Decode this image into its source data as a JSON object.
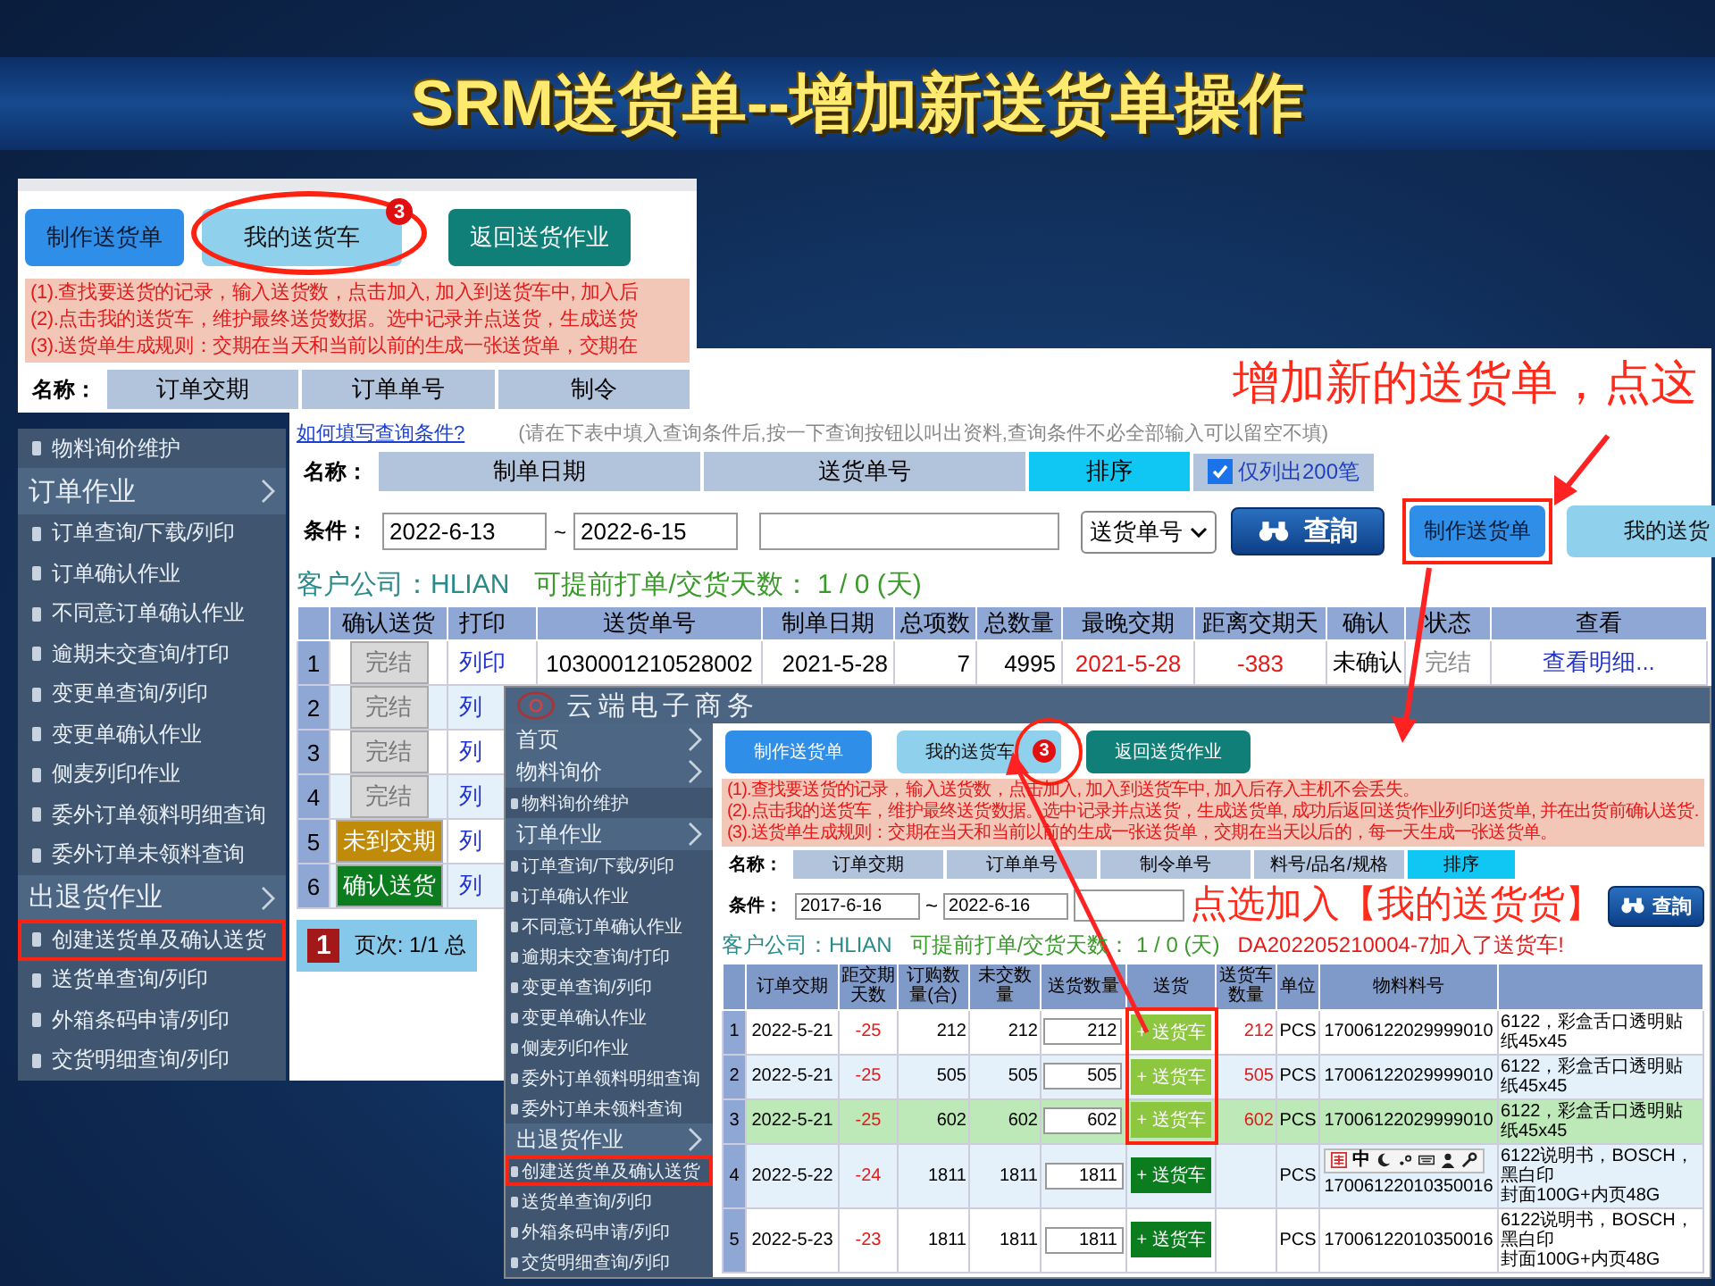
{
  "slide": {
    "title": "SRM送货单--增加新送货单操作"
  },
  "shot_top": {
    "buttons": [
      {
        "label": "制作送货单",
        "kind": "primary",
        "circled": false
      },
      {
        "label": "我的送货车",
        "kind": "cart",
        "badge": "3",
        "circled": true
      },
      {
        "label": "返回送货作业",
        "kind": "back",
        "circled": false
      }
    ],
    "notes": [
      "(1).查找要送货的记录，输入送货数，点击加入, 加入到送货车中, 加入后",
      "(2).点击我的送货车，维护最终送货数据。选中记录并点送货，生成送货",
      "(3).送货单生成规则：交期在当天和当前以前的生成一张送货单，交期在"
    ],
    "filter": {
      "label": "名称：",
      "columns": [
        "订单交期",
        "订单单号",
        "制令"
      ]
    }
  },
  "shot_menu": {
    "items": [
      {
        "kind": "item",
        "label": "物料询价维护",
        "highlighted": false
      },
      {
        "kind": "header",
        "label": "订单作业"
      },
      {
        "kind": "item",
        "label": "订单查询/下载/列印",
        "highlighted": false
      },
      {
        "kind": "item",
        "label": "订单确认作业",
        "highlighted": false
      },
      {
        "kind": "item",
        "label": "不同意订单确认作业",
        "highlighted": false
      },
      {
        "kind": "item",
        "label": "逾期未交查询/打印",
        "highlighted": false
      },
      {
        "kind": "item",
        "label": "变更单查询/列印",
        "highlighted": false
      },
      {
        "kind": "item",
        "label": "变更单确认作业",
        "highlighted": false
      },
      {
        "kind": "item",
        "label": "侧麦列印作业",
        "highlighted": false
      },
      {
        "kind": "item",
        "label": "委外订单领料明细查询",
        "highlighted": false
      },
      {
        "kind": "item",
        "label": "委外订单未领料查询",
        "highlighted": false
      },
      {
        "kind": "header",
        "label": "出退货作业"
      },
      {
        "kind": "item",
        "label": "创建送货单及确认送货",
        "highlighted": true
      },
      {
        "kind": "item",
        "label": "送货单查询/列印",
        "highlighted": false
      },
      {
        "kind": "item",
        "label": "外箱条码申请/列印",
        "highlighted": false
      },
      {
        "kind": "item",
        "label": "交货明细查询/列印",
        "highlighted": false
      }
    ]
  },
  "shot_list": {
    "hint": {
      "link": "如何填写查询条件?",
      "text": "(请在下表中填入查询条件后,按一下查询按钮以叫出资料,查询条件不必全部输入可以留空不填)"
    },
    "filter": {
      "label": "名称：",
      "columns": [
        {
          "label": "制单日期",
          "kind": "field"
        },
        {
          "label": "送货单号",
          "kind": "field"
        },
        {
          "label": "排序",
          "kind": "sort"
        }
      ],
      "only_200": {
        "label": "仅列出200笔",
        "checked": true
      }
    },
    "conditions": {
      "label": "条件：",
      "from": "2022-6-13",
      "separator": "~",
      "to": "2022-6-15",
      "sort_by": "送货单号",
      "search_button": "查詢"
    },
    "buttons": [
      {
        "label": "制作送货单",
        "kind": "primary",
        "highlighted": true
      },
      {
        "label": "我的送货",
        "kind": "cart",
        "highlighted": false
      }
    ],
    "summary": {
      "company": "客户公司：HLIAN",
      "lead_days": "可提前打单/交货天数： 1 / 0 (天)"
    },
    "table": {
      "columns": [
        "确认送货",
        "打印",
        "送货单号",
        "制单日期",
        "总项数",
        "总数量",
        "最晚交期",
        "距离交期天",
        "确认",
        "状态",
        "查看"
      ],
      "rows": [
        {
          "no": "1",
          "confirm": {
            "label": "完结",
            "kind": "done"
          },
          "print": "列印",
          "cells": [
            {
              "text": "1030001210528002",
              "alert": false
            },
            {
              "text": "2021-5-28",
              "alert": false
            },
            {
              "text": "7",
              "alert": false
            },
            {
              "text": "4995",
              "alert": false
            },
            {
              "text": "2021-5-28",
              "alert": true
            },
            {
              "text": "-383",
              "alert": true
            },
            {
              "text": "未确认",
              "alert": false
            },
            {
              "text": "完结",
              "alert": false
            }
          ],
          "view": "查看明细..."
        },
        {
          "no": "2",
          "confirm": {
            "label": "完结",
            "kind": "done"
          },
          "print": "列"
        },
        {
          "no": "3",
          "confirm": {
            "label": "完结",
            "kind": "done"
          },
          "print": "列"
        },
        {
          "no": "4",
          "confirm": {
            "label": "完结",
            "kind": "done"
          },
          "print": "列"
        },
        {
          "no": "5",
          "confirm": {
            "label": "未到交期",
            "kind": "not_due"
          },
          "print": "列"
        },
        {
          "no": "6",
          "confirm": {
            "label": "确认送货",
            "kind": "confirm"
          },
          "print": "列"
        }
      ]
    },
    "pager": {
      "page": "1",
      "text": "页次: 1/1 总"
    }
  },
  "shot_detail": {
    "app_title": "云端电子商务",
    "menu": [
      {
        "kind": "header",
        "label": "首页"
      },
      {
        "kind": "header",
        "label": "物料询价"
      },
      {
        "kind": "item",
        "label": "物料询价维护",
        "highlighted": false
      },
      {
        "kind": "header",
        "label": "订单作业"
      },
      {
        "kind": "item",
        "label": "订单查询/下载/列印",
        "highlighted": false
      },
      {
        "kind": "item",
        "label": "订单确认作业",
        "highlighted": false
      },
      {
        "kind": "item",
        "label": "不同意订单确认作业",
        "highlighted": false
      },
      {
        "kind": "item",
        "label": "逾期未交查询/打印",
        "highlighted": false
      },
      {
        "kind": "item",
        "label": "变更单查询/列印",
        "highlighted": false
      },
      {
        "kind": "item",
        "label": "变更单确认作业",
        "highlighted": false
      },
      {
        "kind": "item",
        "label": "侧麦列印作业",
        "highlighted": false
      },
      {
        "kind": "item",
        "label": "委外订单领料明细查询",
        "highlighted": false
      },
      {
        "kind": "item",
        "label": "委外订单未领料查询",
        "highlighted": false
      },
      {
        "kind": "header",
        "label": "出退货作业"
      },
      {
        "kind": "item",
        "label": "创建送货单及确认送货",
        "highlighted": true
      },
      {
        "kind": "item",
        "label": "送货单查询/列印",
        "highlighted": false
      },
      {
        "kind": "item",
        "label": "外箱条码申请/列印",
        "highlighted": false
      },
      {
        "kind": "item",
        "label": "交货明细查询/列印",
        "highlighted": false
      }
    ],
    "buttons": [
      {
        "label": "制作送货单",
        "kind": "primary",
        "circled": false
      },
      {
        "label": "我的送货车",
        "kind": "cart",
        "badge": "3",
        "circled": true
      },
      {
        "label": "返回送货作业",
        "kind": "back",
        "circled": false
      }
    ],
    "notes": [
      "(1).查找要送货的记录，输入送货数，点击加入, 加入到送货车中, 加入后存入主机不会丢失。",
      "(2).点击我的送货车，维护最终送货数据。选中记录并点送货，生成送货单, 成功后返回送货作业列印送货单, 并在出货前确认送货.",
      "(3).送货单生成规则：交期在当天和当前以前的生成一张送货单，交期在当天以后的，每一天生成一张送货单。"
    ],
    "filter": {
      "label": "名称：",
      "columns": [
        {
          "label": "订单交期",
          "kind": "field"
        },
        {
          "label": "订单单号",
          "kind": "field"
        },
        {
          "label": "制令单号",
          "kind": "field"
        },
        {
          "label": "料号/品名/规格",
          "kind": "field"
        },
        {
          "label": "排序",
          "kind": "sort"
        }
      ]
    },
    "conditions": {
      "label": "条件：",
      "from": "2017-6-16",
      "separator": "~",
      "to": "2022-6-16",
      "search_button": "查詢"
    },
    "summary": {
      "company": "客户公司：HLIAN",
      "lead_days": "可提前打单/交货天数： 1 / 0 (天)",
      "message": "DA202205210004-7加入了送货车!"
    },
    "table": {
      "columns": [
        "订单交期",
        "距交期天数",
        "订购数量(合)",
        "未交数量",
        "送货数量",
        "送货",
        "送货车数量",
        "单位",
        "物料料号"
      ],
      "rows": [
        {
          "no": "1",
          "due": "2022-5-21",
          "days": "-25",
          "ordered": "212",
          "open": "212",
          "qty": "212",
          "button": "+ 送货车",
          "added": true,
          "flagged": true,
          "cart_qty": "212",
          "unit": "PCS",
          "part": "17006122029999010",
          "desc": [
            "6122，彩盒舌口透明贴纸45x45"
          ],
          "selected": false
        },
        {
          "no": "2",
          "due": "2022-5-21",
          "days": "-25",
          "ordered": "505",
          "open": "505",
          "qty": "505",
          "button": "+ 送货车",
          "added": true,
          "flagged": true,
          "cart_qty": "505",
          "unit": "PCS",
          "part": "17006122029999010",
          "desc": [
            "6122，彩盒舌口透明贴纸45x45"
          ],
          "selected": false
        },
        {
          "no": "3",
          "due": "2022-5-21",
          "days": "-25",
          "ordered": "602",
          "open": "602",
          "qty": "602",
          "button": "+ 送货车",
          "added": true,
          "flagged": true,
          "cart_qty": "602",
          "unit": "PCS",
          "part": "17006122029999010",
          "desc": [
            "6122，彩盒舌口透明贴纸45x45"
          ],
          "selected": true
        },
        {
          "no": "4",
          "due": "2022-5-22",
          "days": "-24",
          "ordered": "1811",
          "open": "1811",
          "qty": "1811",
          "button": "+ 送货车",
          "added": false,
          "flagged": false,
          "unit": "PCS",
          "part": "17006122010350016",
          "desc": [
            "6122说明书，BOSCH，黑白印",
            "封面100G+内页48G"
          ],
          "selected": false
        },
        {
          "no": "5",
          "due": "2022-5-23",
          "days": "-23",
          "ordered": "1811",
          "open": "1811",
          "qty": "1811",
          "button": "+ 送货车",
          "added": false,
          "flagged": false,
          "unit": "PCS",
          "part": "17006122010350016",
          "desc": [
            "6122说明书，BOSCH，黑白印",
            "封面100G+内页48G"
          ],
          "selected": false
        }
      ]
    },
    "ime": {
      "mode": "中"
    }
  },
  "callouts": [
    {
      "text": "增加新的送货单，点这"
    },
    {
      "text": "点选加入【我的送货货】"
    }
  ]
}
